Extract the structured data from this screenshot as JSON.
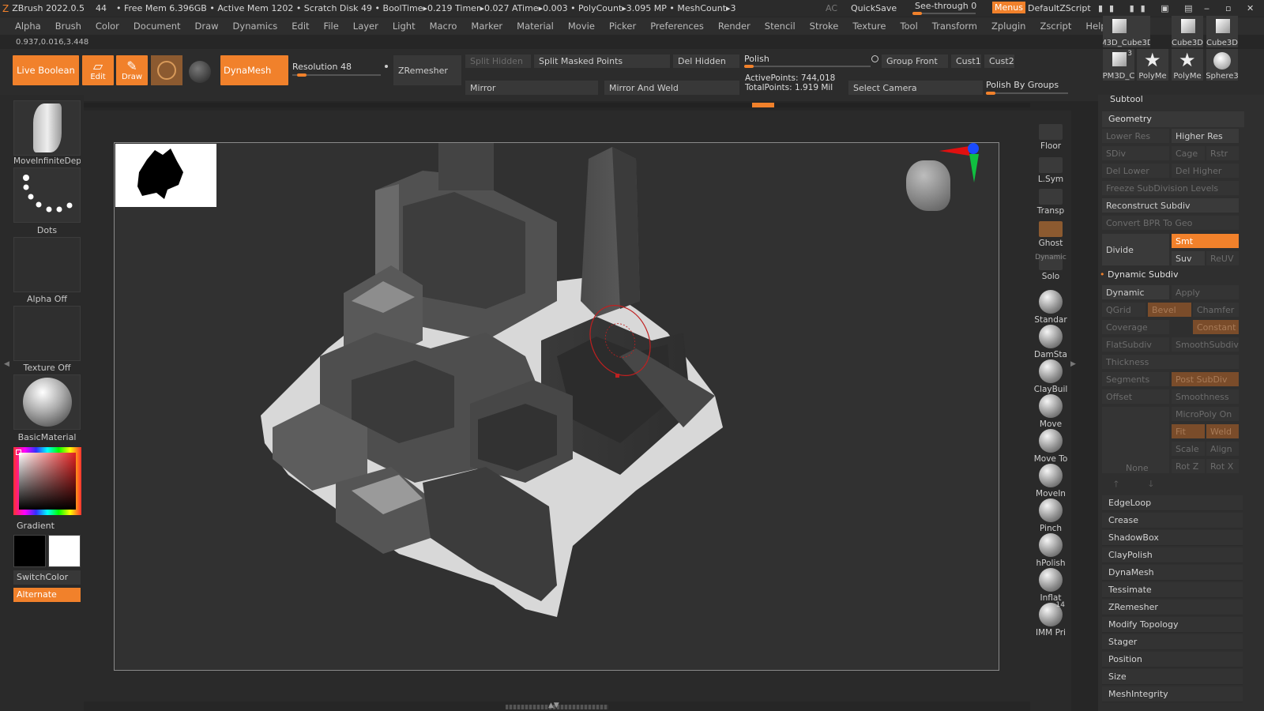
{
  "titlebar": {
    "app": "ZBrush 2022.0.5",
    "count": "44",
    "stats": "• Free Mem 6.396GB • Active Mem 1202 • Scratch Disk 49 •  BoolTime▸0.219 Timer▸0.027 ATime▸0.003 • PolyCount▸3.095 MP • MeshCount▸3",
    "ac": "AC",
    "quicksave": "QuickSave",
    "seethrough": "See-through  0",
    "menus": "Menus",
    "script": "DefaultZScript"
  },
  "menu": [
    "Alpha",
    "Brush",
    "Color",
    "Document",
    "Draw",
    "Dynamics",
    "Edit",
    "File",
    "Layer",
    "Light",
    "Macro",
    "Marker",
    "Material",
    "Movie",
    "Picker",
    "Preferences",
    "Render",
    "Stencil",
    "Stroke",
    "Texture",
    "Tool",
    "Transform",
    "Zplugin",
    "Zscript",
    "Help"
  ],
  "coords": "0.937,0.016,3.448",
  "shelf": {
    "live_boolean": "Live Boolean",
    "edit": "Edit",
    "draw": "Draw",
    "dynamesh": "DynaMesh",
    "resolution": "Resolution 48",
    "zremesher": "ZRemesher",
    "split_hidden": "Split Hidden",
    "split_masked": "Split Masked Points",
    "del_hidden": "Del Hidden",
    "polish": "Polish",
    "group_front": "Group Front",
    "cust1": "Cust1",
    "cust2": "Cust2",
    "mirror": "Mirror",
    "mirror_weld": "Mirror And Weld",
    "active_points": "ActivePoints: 744,018",
    "total_points": "TotalPoints: 1.919 Mil",
    "select_camera": "Select Camera",
    "polish_groups": "Polish By Groups"
  },
  "left": {
    "brush": "MoveInfiniteDep",
    "stroke": "Dots",
    "alpha": "Alpha Off",
    "texture": "Texture Off",
    "material": "BasicMaterial",
    "gradient": "Gradient",
    "switchcolor": "SwitchColor",
    "alternate": "Alternate"
  },
  "rightshelf": [
    {
      "label": "Floor"
    },
    {
      "label": "L.Sym"
    },
    {
      "label": "Transp"
    },
    {
      "label": "Ghost"
    },
    {
      "label": "Solo"
    },
    {
      "label": "Standar"
    },
    {
      "label": "DamSta"
    },
    {
      "label": "ClayBuil"
    },
    {
      "label": "Move"
    },
    {
      "label": "Move To"
    },
    {
      "label": "MoveIn"
    },
    {
      "label": "Pinch"
    },
    {
      "label": "hPolish"
    },
    {
      "label": "Inflat"
    },
    {
      "label": "IMM Pri"
    }
  ],
  "rs_dynamic": "Dynamic",
  "tools": [
    {
      "label": "PM3D_Cube3D1"
    },
    {
      "label": "Cube3D"
    },
    {
      "label": "Cube3D"
    },
    {
      "label": "PM3D_C"
    },
    {
      "label": "PolyMe"
    },
    {
      "label": "PolyMe"
    },
    {
      "label": "Sphere3"
    }
  ],
  "tool_badge": "3",
  "imm_badge": "14",
  "tray": {
    "subtool": "Subtool",
    "geometry": "Geometry",
    "lower_res": "Lower Res",
    "higher_res": "Higher Res",
    "sdiv": "SDiv",
    "cage": "Cage",
    "rstr": "Rstr",
    "del_lower": "Del Lower",
    "del_higher": "Del Higher",
    "freeze": "Freeze SubDivision Levels",
    "reconstruct": "Reconstruct Subdiv",
    "convert_bpr": "Convert BPR To Geo",
    "divide": "Divide",
    "smt": "Smt",
    "suv": "Suv",
    "reuv": "ReUV",
    "dynamic_subdiv": "Dynamic Subdiv",
    "dynamic": "Dynamic",
    "apply": "Apply",
    "qgrid": "QGrid",
    "bevel": "Bevel",
    "chamfer": "Chamfer",
    "coverage": "Coverage",
    "constant": "Constant",
    "flatsubdiv": "FlatSubdiv",
    "smoothsubdiv": "SmoothSubdiv",
    "thickness": "Thickness",
    "segments": "Segments",
    "post_subdiv": "Post SubDiv",
    "offset": "Offset",
    "smoothness": "Smoothness",
    "micropoly": "MicroPoly On",
    "fit": "Fit",
    "weld": "Weld",
    "scale": "Scale",
    "align": "Align",
    "none": "None",
    "rotz": "Rot Z",
    "rotx": "Rot X",
    "sections": [
      "EdgeLoop",
      "Crease",
      "ShadowBox",
      "ClayPolish",
      "DynaMesh",
      "Tessimate",
      "ZRemesher",
      "Modify Topology",
      "Stager",
      "Position",
      "Size",
      "MeshIntegrity"
    ]
  },
  "colors": {
    "accent": "#f1812b",
    "background": "#262626"
  }
}
